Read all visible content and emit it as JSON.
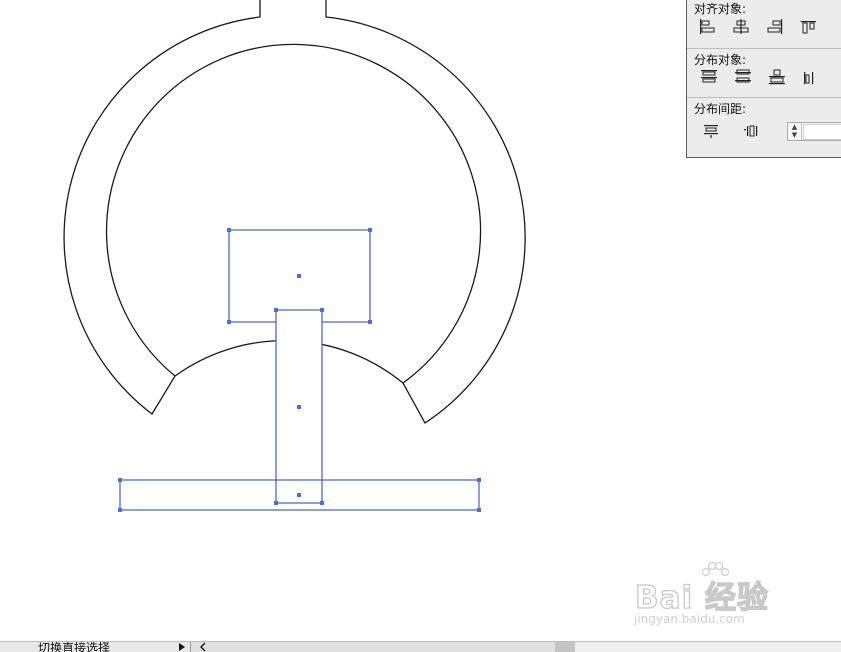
{
  "align_panel": {
    "align_objects_label": "对齐对象:",
    "distribute_objects_label": "分布对象:",
    "distribute_spacing_label": "分布间距:",
    "align_buttons": [
      "horizontal-align-left-icon",
      "horizontal-align-center-icon",
      "horizontal-align-right-icon",
      "vertical-align-top-icon"
    ],
    "distribute_buttons": [
      "vertical-distribute-top-icon",
      "vertical-distribute-center-icon",
      "vertical-distribute-bottom-icon",
      "horizontal-distribute-left-icon"
    ],
    "spacing_buttons": [
      "vertical-distribute-space-icon",
      "horizontal-distribute-space-icon"
    ],
    "spacing_value": ""
  },
  "watermark": {
    "logo_text": "Bai 经验",
    "url": "jingyan.baidu.com"
  },
  "status_bar": {
    "tool_label": "切换直接选择"
  },
  "colors": {
    "selection": "#4a6fd8",
    "stroke": "#1a1a1a",
    "panel_bg": "#ececec"
  }
}
